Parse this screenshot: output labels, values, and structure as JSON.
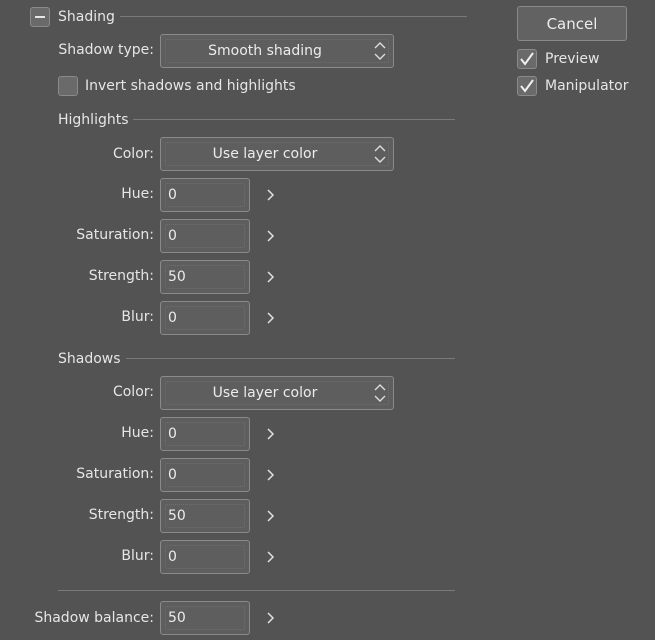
{
  "shading": {
    "title": "Shading",
    "shadow_type_label": "Shadow type:",
    "shadow_type_value": "Smooth shading",
    "invert_label": "Invert shadows and highlights"
  },
  "highlights": {
    "title": "Highlights",
    "color_label": "Color:",
    "color_value": "Use layer color",
    "hue_label": "Hue:",
    "hue_value": "0",
    "saturation_label": "Saturation:",
    "saturation_value": "0",
    "strength_label": "Strength:",
    "strength_value": "50",
    "blur_label": "Blur:",
    "blur_value": "0"
  },
  "shadows": {
    "title": "Shadows",
    "color_label": "Color:",
    "color_value": "Use layer color",
    "hue_label": "Hue:",
    "hue_value": "0",
    "saturation_label": "Saturation:",
    "saturation_value": "0",
    "strength_label": "Strength:",
    "strength_value": "50",
    "blur_label": "Blur:",
    "blur_value": "0"
  },
  "balance": {
    "label": "Shadow balance:",
    "value": "50"
  },
  "side": {
    "cancel_label": "Cancel",
    "preview_label": "Preview",
    "preview_checked": true,
    "manipulator_label": "Manipulator",
    "manipulator_checked": true
  }
}
